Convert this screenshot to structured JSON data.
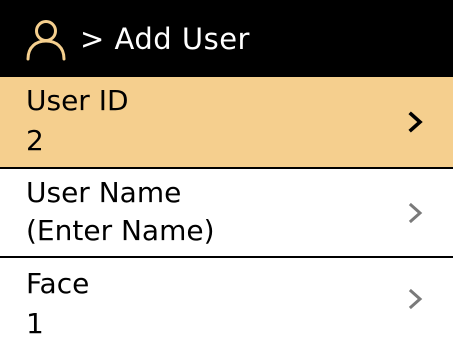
{
  "header": {
    "title": "> Add User",
    "icon": "user-icon"
  },
  "menu": {
    "items": [
      {
        "label": "User ID",
        "value": "2",
        "icon": "chevron-right-icon",
        "selected": true
      },
      {
        "label": "User Name",
        "value": "(Enter Name)",
        "icon": "chevron-right-icon",
        "selected": false
      },
      {
        "label": "Face",
        "value": "1",
        "icon": "chevron-right-icon",
        "selected": false
      }
    ]
  },
  "colors": {
    "header_bg": "#000000",
    "selected_bg": "#f5cf8e",
    "row_bg": "#ffffff",
    "chevron_selected": "#000000",
    "chevron_default": "#7a7a7a"
  }
}
